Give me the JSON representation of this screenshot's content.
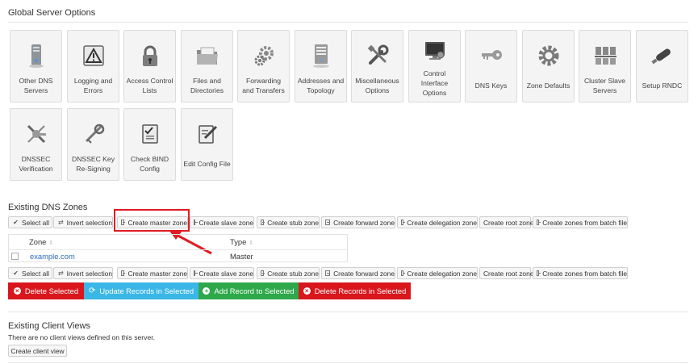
{
  "global": {
    "title": "Global Server Options",
    "tiles": [
      {
        "icon": "server-icon",
        "label": "Other DNS Servers"
      },
      {
        "icon": "warning-icon",
        "label": "Logging and Errors"
      },
      {
        "icon": "padlock-icon",
        "label": "Access Control Lists"
      },
      {
        "icon": "folder-icon",
        "label": "Files and Directories"
      },
      {
        "icon": "gears-icon",
        "label": "Forwarding and Transfers"
      },
      {
        "icon": "computer-tower-icon",
        "label": "Addresses and Topology"
      },
      {
        "icon": "tools-icon",
        "label": "Miscellaneous Options"
      },
      {
        "icon": "control-monitor-icon",
        "label": "Control Interface Options"
      },
      {
        "icon": "key-icon",
        "label": "DNS Keys"
      },
      {
        "icon": "gear-icon",
        "label": "Zone Defaults"
      },
      {
        "icon": "cluster-icon",
        "label": "Cluster Slave Servers"
      },
      {
        "icon": "usb-key-icon",
        "label": "Setup RNDC"
      },
      {
        "icon": "dnssec-verify-icon",
        "label": "DNSSEC Verification"
      },
      {
        "icon": "key-resign-icon",
        "label": "DNSSEC Key Re-Signing"
      },
      {
        "icon": "checklist-icon",
        "label": "Check BIND Config"
      },
      {
        "icon": "edit-file-icon",
        "label": "Edit Config File"
      }
    ]
  },
  "zones": {
    "title": "Existing DNS Zones",
    "toolbar": {
      "select_all": "Select all",
      "invert": "Invert selection",
      "master": "Create master zone",
      "slave": "Create slave zone",
      "stub": "Create stub zone",
      "forward": "Create forward zone",
      "delegation": "Create delegation zone",
      "root": "Create root zone",
      "batch": "Create zones from batch file"
    },
    "columns": {
      "zone": "Zone",
      "type": "Type"
    },
    "rows": [
      {
        "zone": "example.com",
        "type": "Master"
      }
    ],
    "actions": {
      "delete": "Delete Selected",
      "update": "Update Records in Selected",
      "add": "Add Record to Selected",
      "delete_records": "Delete Records in Selected"
    },
    "colors": {
      "red": "#d9161c",
      "blue": "#3ab7e6",
      "green": "#2ea84a",
      "link": "#2a6cc0"
    }
  },
  "views": {
    "title": "Existing Client Views",
    "message": "There are no client views defined on this server.",
    "create_button": "Create client view"
  }
}
